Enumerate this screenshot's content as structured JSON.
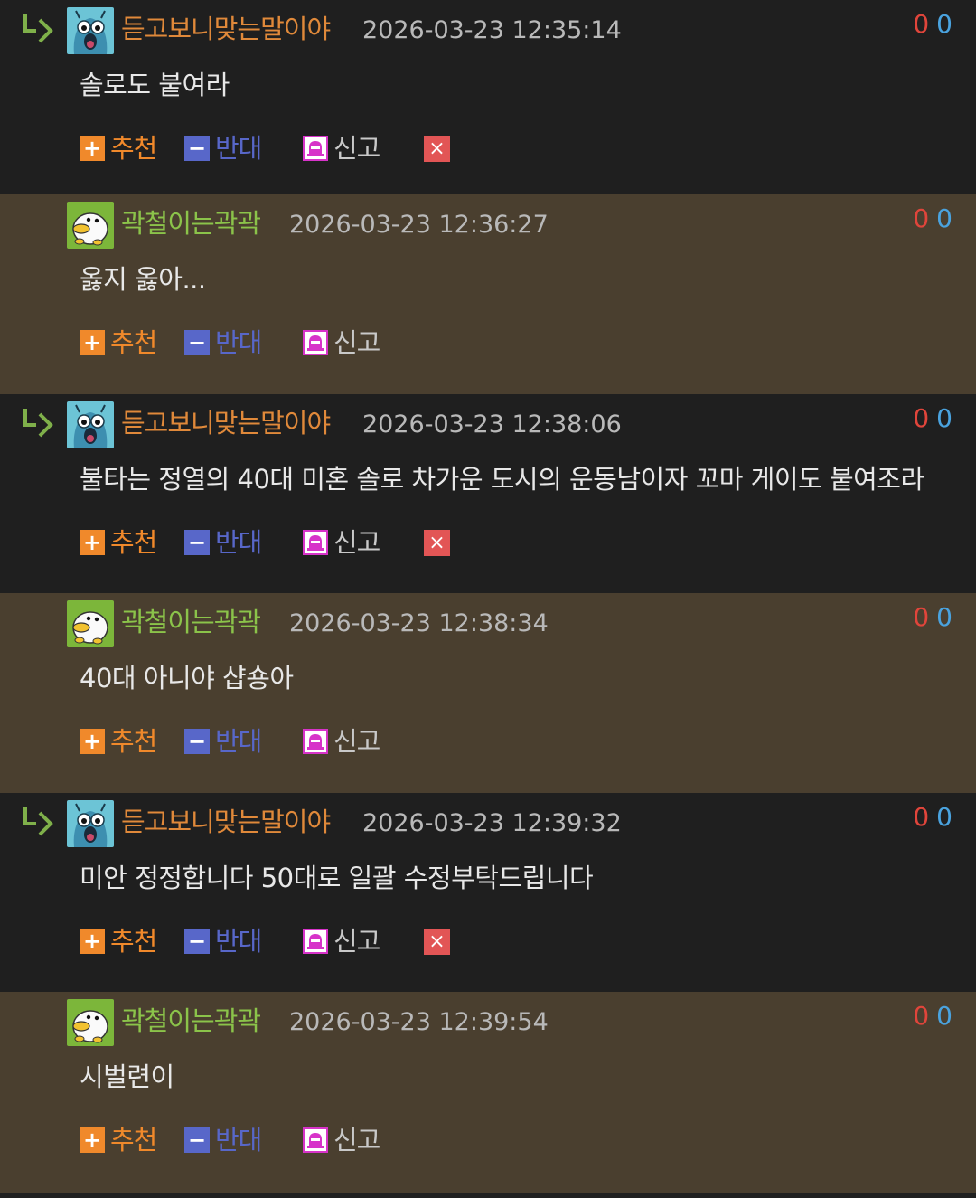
{
  "labels": {
    "recommend": "추천",
    "oppose": "반대",
    "report": "신고",
    "delete_symbol": "×"
  },
  "colors": {
    "dark_row_bg": "#1f1f1f",
    "brown_row_bg": "#4a3f2f",
    "orange_nick": "#e0893a",
    "green_nick": "#8bc34a",
    "upvote": "#e0453b",
    "downvote": "#4aa3df",
    "recommend": "#f0892b",
    "oppose": "#5867c9",
    "report": "#d733c9",
    "delete": "#e25555"
  },
  "comments": [
    {
      "user": "듣고보니맞는말이야",
      "datetime": "2026-03-23 12:35:14",
      "body": "솔로도 붙여라",
      "up": "0",
      "down": "0",
      "is_reply": true,
      "can_delete": true,
      "avatar": "blue-monster-avatar",
      "style": "dark"
    },
    {
      "user": "곽철이는곽곽",
      "datetime": "2026-03-23 12:36:27",
      "body": "옳지 옳아...",
      "up": "0",
      "down": "0",
      "is_reply": false,
      "can_delete": false,
      "avatar": "duck-avatar",
      "style": "brown"
    },
    {
      "user": "듣고보니맞는말이야",
      "datetime": "2026-03-23 12:38:06",
      "body": "불타는 정열의 40대 미혼 솔로 차가운 도시의 운동남이자 꼬마 게이도 붙여조라",
      "up": "0",
      "down": "0",
      "is_reply": true,
      "can_delete": true,
      "avatar": "blue-monster-avatar",
      "style": "dark"
    },
    {
      "user": "곽철이는곽곽",
      "datetime": "2026-03-23 12:38:34",
      "body": "40대 아니야 샵숑아",
      "up": "0",
      "down": "0",
      "is_reply": false,
      "can_delete": false,
      "avatar": "duck-avatar",
      "style": "brown"
    },
    {
      "user": "듣고보니맞는말이야",
      "datetime": "2026-03-23 12:39:32",
      "body": "미안 정정합니다 50대로 일괄 수정부탁드립니다",
      "up": "0",
      "down": "0",
      "is_reply": true,
      "can_delete": true,
      "avatar": "blue-monster-avatar",
      "style": "dark"
    },
    {
      "user": "곽철이는곽곽",
      "datetime": "2026-03-23 12:39:54",
      "body": "시벌련이",
      "up": "0",
      "down": "0",
      "is_reply": false,
      "can_delete": false,
      "avatar": "duck-avatar",
      "style": "brown"
    }
  ]
}
